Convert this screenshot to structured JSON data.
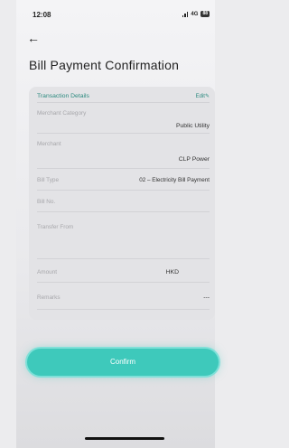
{
  "status_bar": {
    "time": "12:08",
    "network": "4G",
    "battery": "88"
  },
  "header": {
    "title": "Bill Payment Confirmation"
  },
  "details": {
    "section_title": "Transaction Details",
    "edit_label": "Edit",
    "rows": [
      {
        "label": "Merchant Category",
        "value": "Public Utility"
      },
      {
        "label": "Merchant",
        "value": "CLP Power"
      },
      {
        "label": "Bill Type",
        "value": "02 – Electricity Bill Payment"
      },
      {
        "label": "Bill No.",
        "value": ""
      },
      {
        "label": "Transfer From",
        "value": ""
      },
      {
        "label": "Amount",
        "value": "HKD"
      },
      {
        "label": "Remarks",
        "value": "---"
      }
    ]
  },
  "actions": {
    "confirm_label": "Confirm"
  }
}
